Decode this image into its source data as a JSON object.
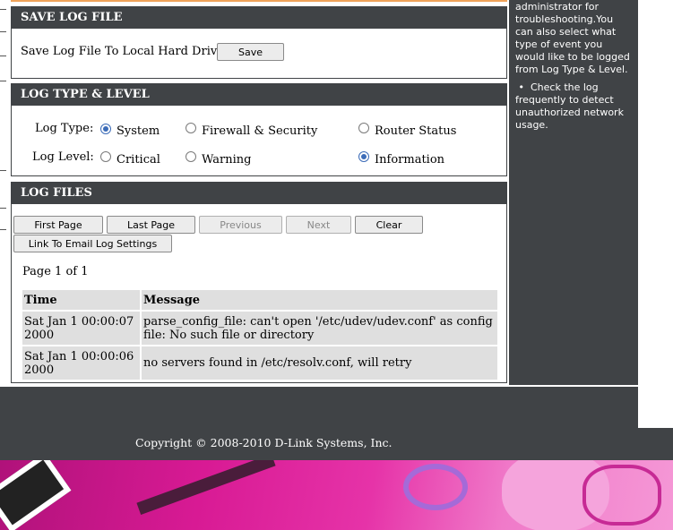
{
  "save_section": {
    "title": "SAVE LOG FILE",
    "label": "Save Log File To Local Hard Drive.",
    "save_button": "Save"
  },
  "type_section": {
    "title": "LOG TYPE & LEVEL",
    "log_type_label": "Log Type:",
    "log_level_label": "Log Level:",
    "types": [
      {
        "label": "System",
        "checked": true
      },
      {
        "label": "Firewall & Security",
        "checked": false
      },
      {
        "label": "Router Status",
        "checked": false
      }
    ],
    "levels": [
      {
        "label": "Critical",
        "checked": false
      },
      {
        "label": "Warning",
        "checked": false
      },
      {
        "label": "Information",
        "checked": true
      }
    ]
  },
  "files_section": {
    "title": "LOG FILES",
    "buttons": {
      "first": "First Page",
      "last": "Last Page",
      "previous": "Previous",
      "next": "Next",
      "clear": "Clear",
      "email": "Link To Email Log Settings"
    },
    "page_info": "Page 1 of 1",
    "columns": [
      "Time",
      "Message"
    ],
    "rows": [
      {
        "time": "Sat Jan 1 00:00:07 2000",
        "message": "parse_config_file: can't open '/etc/udev/udev.conf' as config file: No such file or directory"
      },
      {
        "time": "Sat Jan 1 00:00:06 2000",
        "message": "no servers found in /etc/resolv.conf, will retry"
      }
    ]
  },
  "help": {
    "text": "administrator for troubleshooting.You can also select what type of event you would like to be logged from Log Type & Level.",
    "bullet": "Check the log frequently to detect unauthorized network usage."
  },
  "footer": {
    "copyright": "Copyright © 2008-2010 D-Link Systems, Inc."
  },
  "colors": {
    "frame": "#404346",
    "accent": "#f0a35a",
    "radio_checked": "#3c6cb8"
  }
}
